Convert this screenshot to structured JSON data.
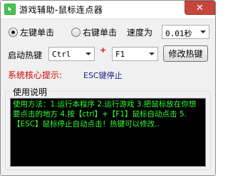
{
  "window": {
    "title": "游戏辅助-鼠标连点器",
    "close_glyph": "✕",
    "app_icon": "green-cursor-app-icon"
  },
  "mouse_button": {
    "left_label": "左键单击",
    "right_label": "右键单击",
    "selected": "left"
  },
  "speed": {
    "label": "速度为",
    "value": "0.01秒"
  },
  "hotkey": {
    "label": "启动热键",
    "modifier": "Ctrl",
    "plus": "+",
    "key": "F1",
    "change_button": "修改热键"
  },
  "hint": {
    "label": "系统核心提示:",
    "status": "ESC键停止"
  },
  "instructions": {
    "group_title": "使用说明",
    "text": "使用方法：1.运行本程序 2.运行游戏 3.把鼠标放在你想要点击的地方 4.按【ctrl】+【F1】鼠标自动点击 5.【ESC】鼠标停止自动点击！热键可以修改.."
  },
  "colors": {
    "console_bg": "#000000",
    "console_text": "#33ff33",
    "hint_red": "#d00000",
    "status_blue": "#1a1a8a",
    "close_red": "#c7463b"
  }
}
